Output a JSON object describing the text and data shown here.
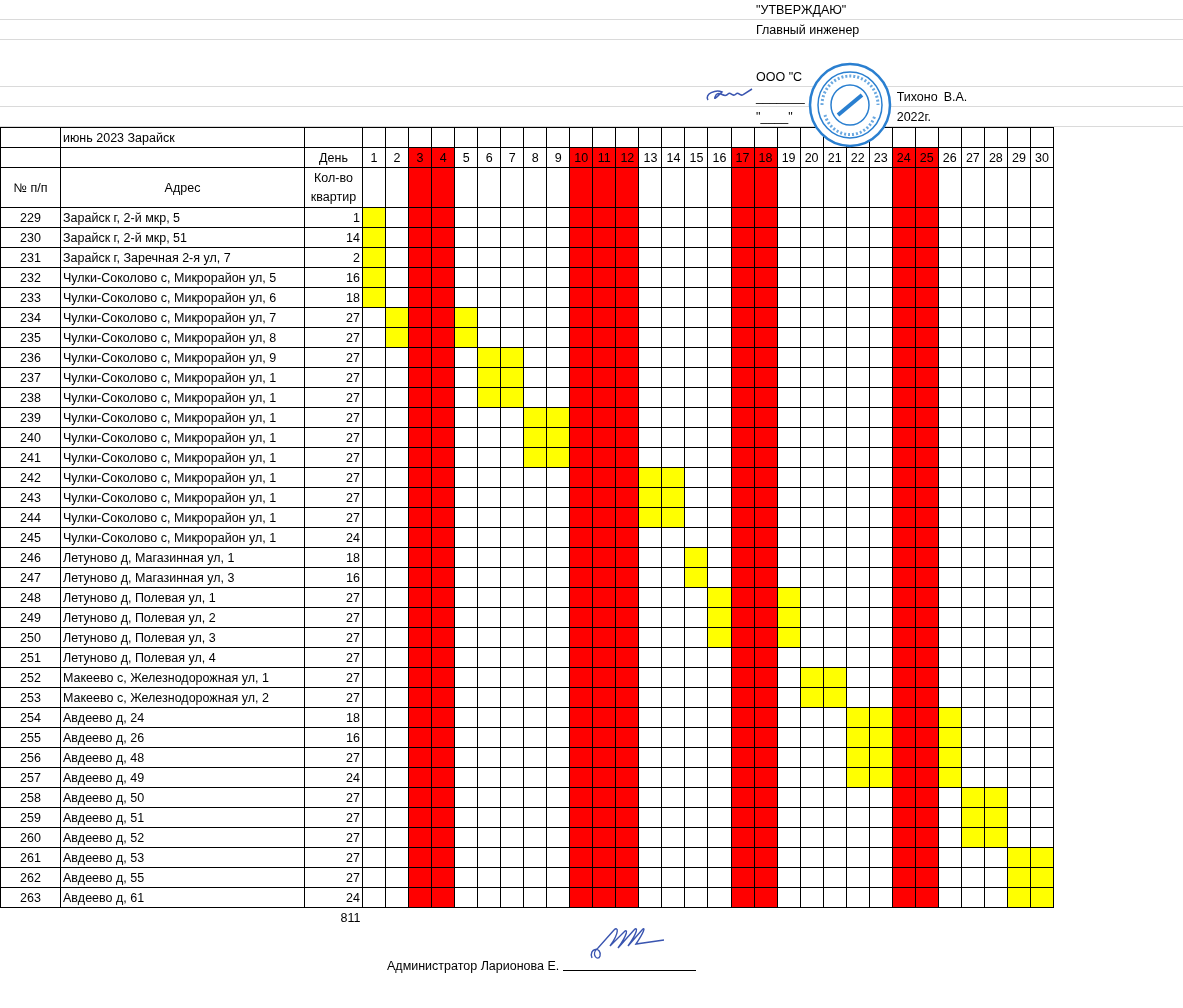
{
  "approval": {
    "title": "\"УТВЕРЖДАЮ\"",
    "position": "Главный инженер",
    "company": "ООО \"С",
    "signature_line": "_______",
    "signer": "Тихоно",
    "initials": "В.А.",
    "date_blank": "\"____\"",
    "date_year": "2022г."
  },
  "sheet": {
    "title": "июнь 2023 Зарайск",
    "day_label": "День",
    "columns": [
      "№ п/п",
      "Адрес",
      "Кол-во квартир"
    ],
    "days": [
      {
        "label": "1",
        "weekend": false
      },
      {
        "label": "2",
        "weekend": false
      },
      {
        "label": "3",
        "weekend": true
      },
      {
        "label": "4",
        "weekend": true
      },
      {
        "label": "5",
        "weekend": false
      },
      {
        "label": "6",
        "weekend": false
      },
      {
        "label": "7",
        "weekend": false
      },
      {
        "label": "8",
        "weekend": false
      },
      {
        "label": "9",
        "weekend": false
      },
      {
        "label": "10",
        "weekend": true
      },
      {
        "label": "11",
        "weekend": true
      },
      {
        "label": "12",
        "weekend": true
      },
      {
        "label": "13",
        "weekend": false
      },
      {
        "label": "14",
        "weekend": false
      },
      {
        "label": "15",
        "weekend": false
      },
      {
        "label": "16",
        "weekend": false
      },
      {
        "label": "17",
        "weekend": true
      },
      {
        "label": "18",
        "weekend": true
      },
      {
        "label": "19",
        "weekend": false
      },
      {
        "label": "20",
        "weekend": false
      },
      {
        "label": "21",
        "weekend": false
      },
      {
        "label": "22",
        "weekend": false
      },
      {
        "label": "23",
        "weekend": false
      },
      {
        "label": "24",
        "weekend": true
      },
      {
        "label": "25",
        "weekend": true
      },
      {
        "label": "26",
        "weekend": false
      },
      {
        "label": "27",
        "weekend": false
      },
      {
        "label": "28",
        "weekend": false
      },
      {
        "label": "29",
        "weekend": false
      },
      {
        "label": "30",
        "weekend": false
      }
    ],
    "rows": [
      {
        "number": "229",
        "address": "Зарайск г, 2-й мкр, 5",
        "apartments": "1",
        "marked": [
          true,
          false,
          false,
          false,
          false,
          false,
          false,
          false,
          false,
          false,
          false,
          false,
          false,
          false,
          false,
          false,
          false,
          false,
          false,
          false,
          false,
          false,
          false,
          false,
          false,
          false,
          false,
          false,
          false,
          false
        ]
      },
      {
        "number": "230",
        "address": "Зарайск г, 2-й мкр, 51",
        "apartments": "14",
        "marked": [
          true,
          false,
          false,
          false,
          false,
          false,
          false,
          false,
          false,
          false,
          false,
          false,
          false,
          false,
          false,
          false,
          false,
          false,
          false,
          false,
          false,
          false,
          false,
          false,
          false,
          false,
          false,
          false,
          false,
          false
        ]
      },
      {
        "number": "231",
        "address": "Зарайск г, Заречная 2-я ул, 7",
        "apartments": "2",
        "marked": [
          true,
          false,
          false,
          false,
          false,
          false,
          false,
          false,
          false,
          false,
          false,
          false,
          false,
          false,
          false,
          false,
          false,
          false,
          false,
          false,
          false,
          false,
          false,
          false,
          false,
          false,
          false,
          false,
          false,
          false
        ]
      },
      {
        "number": "232",
        "address": "Чулки-Соколово с, Микрорайон ул, 5",
        "apartments": "16",
        "marked": [
          true,
          false,
          false,
          false,
          false,
          false,
          false,
          false,
          false,
          false,
          false,
          false,
          false,
          false,
          false,
          false,
          false,
          false,
          false,
          false,
          false,
          false,
          false,
          false,
          false,
          false,
          false,
          false,
          false,
          false
        ]
      },
      {
        "number": "233",
        "address": "Чулки-Соколово с, Микрорайон ул, 6",
        "apartments": "18",
        "marked": [
          true,
          false,
          false,
          false,
          false,
          false,
          false,
          false,
          false,
          false,
          false,
          false,
          false,
          false,
          false,
          false,
          false,
          false,
          false,
          false,
          false,
          false,
          false,
          false,
          false,
          false,
          false,
          false,
          false,
          false
        ]
      },
      {
        "number": "234",
        "address": "Чулки-Соколово с, Микрорайон ул, 7",
        "apartments": "27",
        "marked": [
          false,
          true,
          false,
          false,
          true,
          false,
          false,
          false,
          false,
          false,
          false,
          false,
          false,
          false,
          false,
          false,
          false,
          false,
          false,
          false,
          false,
          false,
          false,
          false,
          false,
          false,
          false,
          false,
          false,
          false
        ]
      },
      {
        "number": "235",
        "address": "Чулки-Соколово с, Микрорайон ул, 8",
        "apartments": "27",
        "marked": [
          false,
          true,
          false,
          false,
          true,
          false,
          false,
          false,
          false,
          false,
          false,
          false,
          false,
          false,
          false,
          false,
          false,
          false,
          false,
          false,
          false,
          false,
          false,
          false,
          false,
          false,
          false,
          false,
          false,
          false
        ]
      },
      {
        "number": "236",
        "address": "Чулки-Соколово с, Микрорайон ул, 9",
        "apartments": "27",
        "marked": [
          false,
          false,
          false,
          false,
          false,
          true,
          true,
          false,
          false,
          false,
          false,
          false,
          false,
          false,
          false,
          false,
          false,
          false,
          false,
          false,
          false,
          false,
          false,
          false,
          false,
          false,
          false,
          false,
          false,
          false
        ]
      },
      {
        "number": "237",
        "address": "Чулки-Соколово с, Микрорайон ул, 1",
        "apartments": "27",
        "marked": [
          false,
          false,
          false,
          false,
          false,
          true,
          true,
          false,
          false,
          false,
          false,
          false,
          false,
          false,
          false,
          false,
          false,
          false,
          false,
          false,
          false,
          false,
          false,
          false,
          false,
          false,
          false,
          false,
          false,
          false
        ]
      },
      {
        "number": "238",
        "address": "Чулки-Соколово с, Микрорайон ул, 1",
        "apartments": "27",
        "marked": [
          false,
          false,
          false,
          false,
          false,
          true,
          true,
          false,
          false,
          false,
          false,
          false,
          false,
          false,
          false,
          false,
          false,
          false,
          false,
          false,
          false,
          false,
          false,
          false,
          false,
          false,
          false,
          false,
          false,
          false
        ]
      },
      {
        "number": "239",
        "address": "Чулки-Соколово с, Микрорайон ул, 1",
        "apartments": "27",
        "marked": [
          false,
          false,
          false,
          false,
          false,
          false,
          false,
          true,
          true,
          false,
          false,
          false,
          false,
          false,
          false,
          false,
          false,
          false,
          false,
          false,
          false,
          false,
          false,
          false,
          false,
          false,
          false,
          false,
          false,
          false
        ]
      },
      {
        "number": "240",
        "address": "Чулки-Соколово с, Микрорайон ул, 1",
        "apartments": "27",
        "marked": [
          false,
          false,
          false,
          false,
          false,
          false,
          false,
          true,
          true,
          false,
          false,
          false,
          false,
          false,
          false,
          false,
          false,
          false,
          false,
          false,
          false,
          false,
          false,
          false,
          false,
          false,
          false,
          false,
          false,
          false
        ]
      },
      {
        "number": "241",
        "address": "Чулки-Соколово с, Микрорайон ул, 1",
        "apartments": "27",
        "marked": [
          false,
          false,
          false,
          false,
          false,
          false,
          false,
          true,
          true,
          false,
          false,
          false,
          false,
          false,
          false,
          false,
          false,
          false,
          false,
          false,
          false,
          false,
          false,
          false,
          false,
          false,
          false,
          false,
          false,
          false
        ]
      },
      {
        "number": "242",
        "address": "Чулки-Соколово с, Микрорайон ул, 1",
        "apartments": "27",
        "marked": [
          false,
          false,
          false,
          false,
          false,
          false,
          false,
          false,
          false,
          false,
          false,
          false,
          true,
          true,
          false,
          false,
          false,
          false,
          false,
          false,
          false,
          false,
          false,
          false,
          false,
          false,
          false,
          false,
          false,
          false
        ]
      },
      {
        "number": "243",
        "address": "Чулки-Соколово с, Микрорайон ул, 1",
        "apartments": "27",
        "marked": [
          false,
          false,
          false,
          false,
          false,
          false,
          false,
          false,
          false,
          false,
          false,
          false,
          true,
          true,
          false,
          false,
          false,
          false,
          false,
          false,
          false,
          false,
          false,
          false,
          false,
          false,
          false,
          false,
          false,
          false
        ]
      },
      {
        "number": "244",
        "address": "Чулки-Соколово с, Микрорайон ул, 1",
        "apartments": "27",
        "marked": [
          false,
          false,
          false,
          false,
          false,
          false,
          false,
          false,
          false,
          false,
          false,
          false,
          true,
          true,
          false,
          false,
          false,
          false,
          false,
          false,
          false,
          false,
          false,
          false,
          false,
          false,
          false,
          false,
          false,
          false
        ]
      },
      {
        "number": "245",
        "address": "Чулки-Соколово с, Микрорайон ул, 1",
        "apartments": "24",
        "marked": [
          false,
          false,
          false,
          false,
          false,
          false,
          false,
          false,
          false,
          false,
          false,
          false,
          false,
          false,
          false,
          false,
          false,
          false,
          false,
          false,
          false,
          false,
          false,
          false,
          false,
          false,
          false,
          false,
          false,
          false
        ]
      },
      {
        "number": "246",
        "address": "Летуново д, Магазинная ул, 1",
        "apartments": "18",
        "marked": [
          false,
          false,
          false,
          false,
          false,
          false,
          false,
          false,
          false,
          false,
          false,
          false,
          false,
          false,
          true,
          false,
          false,
          false,
          false,
          false,
          false,
          false,
          false,
          false,
          false,
          false,
          false,
          false,
          false,
          false
        ]
      },
      {
        "number": "247",
        "address": "Летуново д, Магазинная ул, 3",
        "apartments": "16",
        "marked": [
          false,
          false,
          false,
          false,
          false,
          false,
          false,
          false,
          false,
          false,
          false,
          false,
          false,
          false,
          true,
          false,
          false,
          false,
          false,
          false,
          false,
          false,
          false,
          false,
          false,
          false,
          false,
          false,
          false,
          false
        ]
      },
      {
        "number": "248",
        "address": "Летуново д, Полевая ул, 1",
        "apartments": "27",
        "marked": [
          false,
          false,
          false,
          false,
          false,
          false,
          false,
          false,
          false,
          false,
          false,
          false,
          false,
          false,
          false,
          true,
          false,
          false,
          true,
          false,
          false,
          false,
          false,
          false,
          false,
          false,
          false,
          false,
          false,
          false
        ]
      },
      {
        "number": "249",
        "address": "Летуново д, Полевая ул, 2",
        "apartments": "27",
        "marked": [
          false,
          false,
          false,
          false,
          false,
          false,
          false,
          false,
          false,
          false,
          false,
          false,
          false,
          false,
          false,
          true,
          false,
          false,
          true,
          false,
          false,
          false,
          false,
          false,
          false,
          false,
          false,
          false,
          false,
          false
        ]
      },
      {
        "number": "250",
        "address": "Летуново д, Полевая ул, 3",
        "apartments": "27",
        "marked": [
          false,
          false,
          false,
          false,
          false,
          false,
          false,
          false,
          false,
          false,
          false,
          false,
          false,
          false,
          false,
          true,
          false,
          false,
          true,
          false,
          false,
          false,
          false,
          false,
          false,
          false,
          false,
          false,
          false,
          false
        ]
      },
      {
        "number": "251",
        "address": "Летуново д, Полевая ул, 4",
        "apartments": "27",
        "marked": [
          false,
          false,
          false,
          false,
          false,
          false,
          false,
          false,
          false,
          false,
          false,
          false,
          false,
          false,
          false,
          false,
          false,
          false,
          false,
          false,
          false,
          false,
          false,
          false,
          false,
          false,
          false,
          false,
          false,
          false
        ]
      },
      {
        "number": "252",
        "address": "Макеево с, Железнодорожная ул, 1",
        "apartments": "27",
        "marked": [
          false,
          false,
          false,
          false,
          false,
          false,
          false,
          false,
          false,
          false,
          false,
          false,
          false,
          false,
          false,
          false,
          false,
          false,
          false,
          true,
          true,
          false,
          false,
          false,
          false,
          false,
          false,
          false,
          false,
          false
        ]
      },
      {
        "number": "253",
        "address": "Макеево с, Железнодорожная ул, 2",
        "apartments": "27",
        "marked": [
          false,
          false,
          false,
          false,
          false,
          false,
          false,
          false,
          false,
          false,
          false,
          false,
          false,
          false,
          false,
          false,
          false,
          false,
          false,
          true,
          true,
          false,
          false,
          false,
          false,
          false,
          false,
          false,
          false,
          false
        ]
      },
      {
        "number": "254",
        "address": "Авдеево д, 24",
        "apartments": "18",
        "marked": [
          false,
          false,
          false,
          false,
          false,
          false,
          false,
          false,
          false,
          false,
          false,
          false,
          false,
          false,
          false,
          false,
          false,
          false,
          false,
          false,
          false,
          true,
          true,
          false,
          false,
          true,
          false,
          false,
          false,
          false
        ]
      },
      {
        "number": "255",
        "address": "Авдеево д, 26",
        "apartments": "16",
        "marked": [
          false,
          false,
          false,
          false,
          false,
          false,
          false,
          false,
          false,
          false,
          false,
          false,
          false,
          false,
          false,
          false,
          false,
          false,
          false,
          false,
          false,
          true,
          true,
          false,
          false,
          true,
          false,
          false,
          false,
          false
        ]
      },
      {
        "number": "256",
        "address": "Авдеево д, 48",
        "apartments": "27",
        "marked": [
          false,
          false,
          false,
          false,
          false,
          false,
          false,
          false,
          false,
          false,
          false,
          false,
          false,
          false,
          false,
          false,
          false,
          false,
          false,
          false,
          false,
          true,
          true,
          false,
          false,
          true,
          false,
          false,
          false,
          false
        ]
      },
      {
        "number": "257",
        "address": "Авдеево д, 49",
        "apartments": "24",
        "marked": [
          false,
          false,
          false,
          false,
          false,
          false,
          false,
          false,
          false,
          false,
          false,
          false,
          false,
          false,
          false,
          false,
          false,
          false,
          false,
          false,
          false,
          true,
          true,
          false,
          false,
          true,
          false,
          false,
          false,
          false
        ]
      },
      {
        "number": "258",
        "address": "Авдеево д, 50",
        "apartments": "27",
        "marked": [
          false,
          false,
          false,
          false,
          false,
          false,
          false,
          false,
          false,
          false,
          false,
          false,
          false,
          false,
          false,
          false,
          false,
          false,
          false,
          false,
          false,
          false,
          false,
          false,
          false,
          false,
          true,
          true,
          false,
          false
        ]
      },
      {
        "number": "259",
        "address": "Авдеево д, 51",
        "apartments": "27",
        "marked": [
          false,
          false,
          false,
          false,
          false,
          false,
          false,
          false,
          false,
          false,
          false,
          false,
          false,
          false,
          false,
          false,
          false,
          false,
          false,
          false,
          false,
          false,
          false,
          false,
          false,
          false,
          true,
          true,
          false,
          false
        ]
      },
      {
        "number": "260",
        "address": "Авдеево д, 52",
        "apartments": "27",
        "marked": [
          false,
          false,
          false,
          false,
          false,
          false,
          false,
          false,
          false,
          false,
          false,
          false,
          false,
          false,
          false,
          false,
          false,
          false,
          false,
          false,
          false,
          false,
          false,
          false,
          false,
          false,
          true,
          true,
          false,
          false
        ]
      },
      {
        "number": "261",
        "address": "Авдеево д, 53",
        "apartments": "27",
        "marked": [
          false,
          false,
          false,
          false,
          false,
          false,
          false,
          false,
          false,
          false,
          false,
          false,
          false,
          false,
          false,
          false,
          false,
          false,
          false,
          false,
          false,
          false,
          false,
          false,
          false,
          false,
          false,
          false,
          true,
          true
        ]
      },
      {
        "number": "262",
        "address": "Авдеево д, 55",
        "apartments": "27",
        "marked": [
          false,
          false,
          false,
          false,
          false,
          false,
          false,
          false,
          false,
          false,
          false,
          false,
          false,
          false,
          false,
          false,
          false,
          false,
          false,
          false,
          false,
          false,
          false,
          false,
          false,
          false,
          false,
          false,
          true,
          true
        ]
      },
      {
        "number": "263",
        "address": "Авдеево д, 61",
        "apartments": "24",
        "marked": [
          false,
          false,
          false,
          false,
          false,
          false,
          false,
          false,
          false,
          false,
          false,
          false,
          false,
          false,
          false,
          false,
          false,
          false,
          false,
          false,
          false,
          false,
          false,
          false,
          false,
          false,
          false,
          false,
          true,
          true
        ]
      }
    ],
    "total": "811"
  },
  "footer": {
    "signatory": "Администратор Ларионова Е."
  }
}
